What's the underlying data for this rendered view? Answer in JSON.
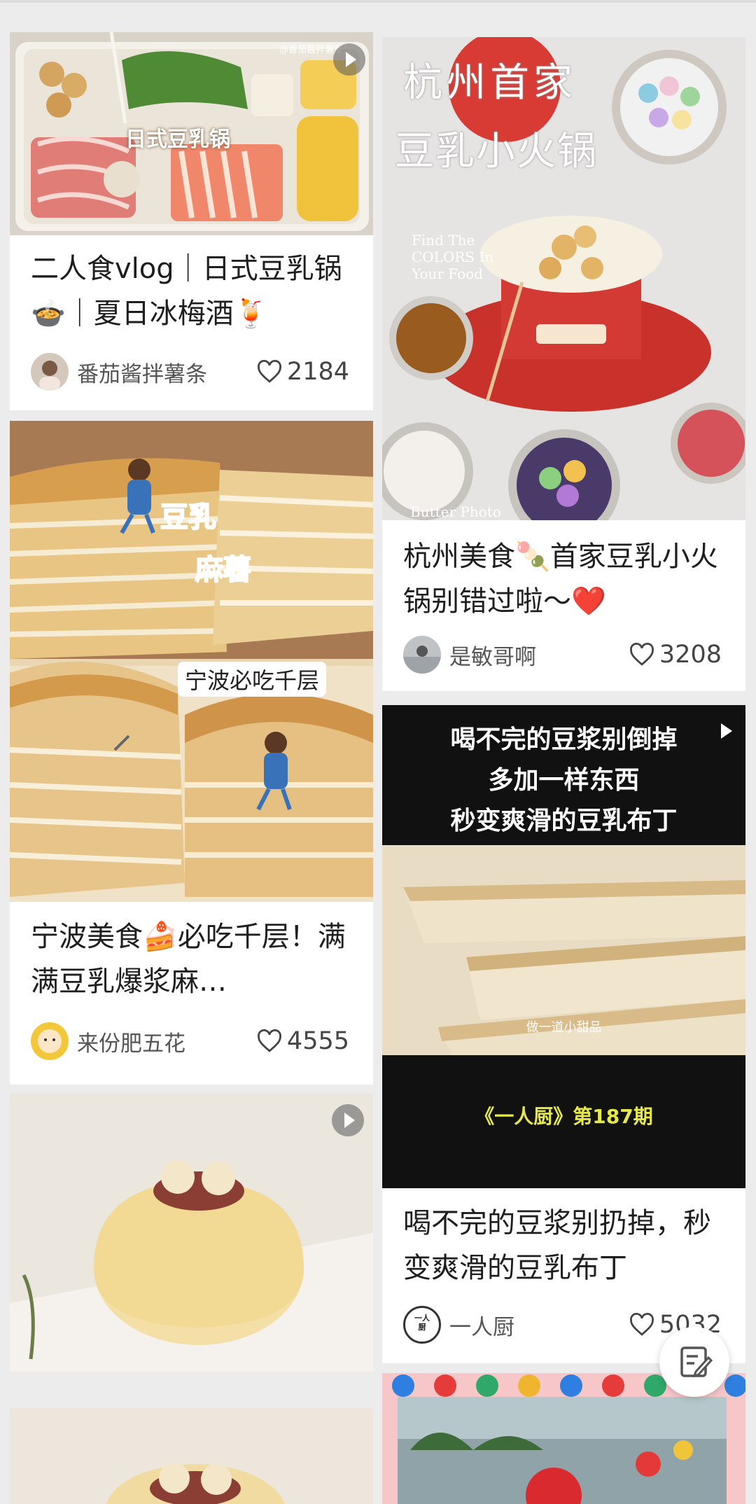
{
  "feed": [
    {
      "title": "二人食vlog｜日式豆乳锅🍲｜夏日冰梅酒🍹",
      "author": "番茄酱拌薯条",
      "likes": "2184",
      "image_text": [
        "日式豆乳锅",
        "@番茄酱拌薯条"
      ],
      "is_video": true
    },
    {
      "title": "杭州美食🍡首家豆乳小火锅别错过啦～❤️",
      "author": "是敏哥啊",
      "likes": "3208",
      "image_text": [
        "杭州首家",
        "豆乳小火锅",
        "Find The COLORS In Your Food",
        "Butter Photo"
      ],
      "is_video": false
    },
    {
      "title": "宁波美食🍰必吃千层！满满豆乳爆浆麻…",
      "author": "来份肥五花",
      "likes": "4555",
      "image_text": [
        "豆乳",
        "麻薯",
        "宁波必吃千层"
      ],
      "is_video": false
    },
    {
      "title": "喝不完的豆浆别扔掉，秒变爽滑的豆乳布丁",
      "author": "一人厨",
      "likes": "5032",
      "image_text": [
        "喝不完的豆浆别倒掉",
        "多加一样东西",
        "秒变爽滑的豆乳布丁",
        "做一道小甜品",
        "《一人厨》第187期"
      ],
      "is_video": true
    },
    {
      "is_video": true
    },
    {
      "is_video": false
    },
    {
      "is_video": false
    }
  ],
  "avatar_text": "一人厨",
  "colors": {
    "background": "#ececec",
    "card": "#ffffff",
    "title": "#1e1e1e",
    "meta": "#555555",
    "heart": "#444444",
    "video_bg": "#111111",
    "pudding_caption": "#e7e94a"
  },
  "icons": [
    "heart-icon",
    "play-icon",
    "edit-note-icon"
  ]
}
